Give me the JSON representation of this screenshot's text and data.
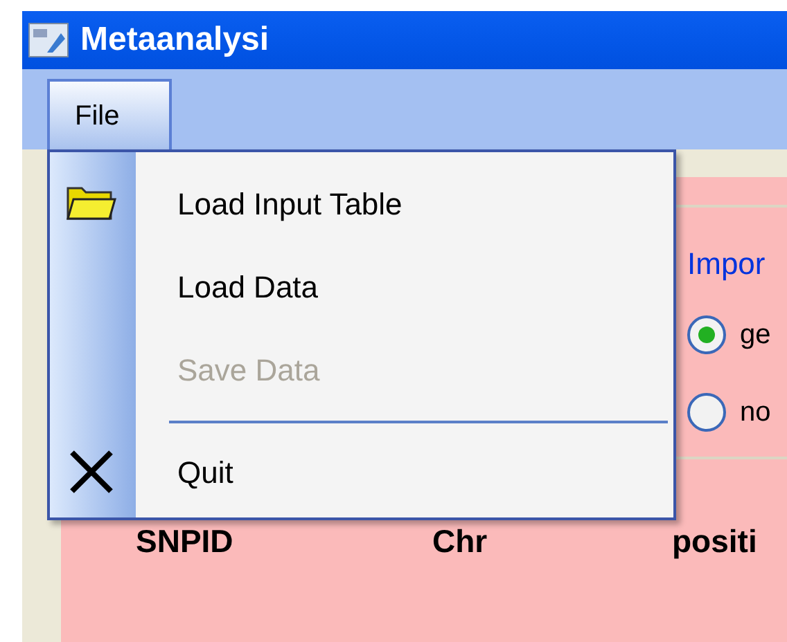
{
  "window": {
    "title": "Metaanalysi"
  },
  "menu_bar": [
    {
      "label": "File",
      "selected": true
    }
  ],
  "file_menu": [
    {
      "kind": "item",
      "label": "Load Input Table",
      "disabled": false
    },
    {
      "kind": "item",
      "label": "Load Data",
      "disabled": false
    },
    {
      "kind": "item",
      "label": "Save Data",
      "disabled": true
    },
    {
      "kind": "separator"
    },
    {
      "kind": "item",
      "label": "Quit",
      "disabled": false
    }
  ],
  "import_group": {
    "label": "Impor",
    "options": [
      {
        "label": "ge",
        "selected": true
      },
      {
        "label": "no",
        "selected": false
      }
    ]
  },
  "table": {
    "columns": [
      "SNPID",
      "Chr",
      "positi"
    ]
  }
}
